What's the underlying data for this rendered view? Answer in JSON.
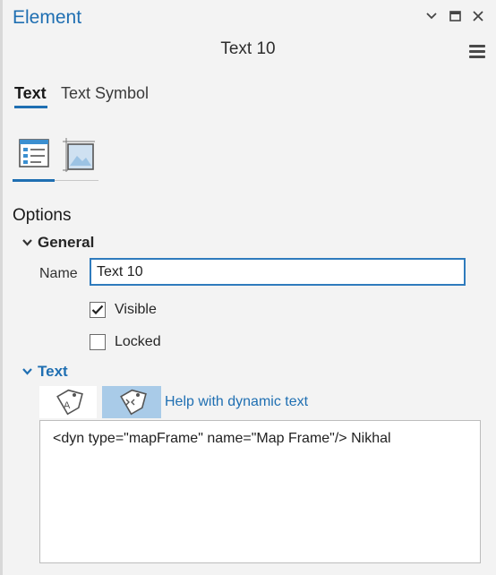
{
  "pane": {
    "title": "Element",
    "controls": [
      "chevron-down-icon",
      "maximize-icon",
      "close-icon"
    ]
  },
  "element": {
    "name": "Text 10"
  },
  "tabs": [
    {
      "label": "Text",
      "active": true
    },
    {
      "label": "Text Symbol",
      "active": false
    }
  ],
  "icon_tabs": [
    {
      "icon": "options-icon",
      "active": true
    },
    {
      "icon": "placement-icon",
      "active": false
    }
  ],
  "options": {
    "header": "Options",
    "general": {
      "label": "General",
      "name_label": "Name",
      "name_value": "Text 10",
      "visible_label": "Visible",
      "visible_checked": true,
      "locked_label": "Locked",
      "locked_checked": false
    },
    "text": {
      "label": "Text",
      "help_link": "Help with dynamic text",
      "value": "<dyn type=\"mapFrame\" name=\"Map Frame\"/> Nikhal"
    }
  },
  "colors": {
    "accent": "#1f6fb2",
    "selected_button": "#a9cbe8",
    "background": "#f3f3f3"
  }
}
